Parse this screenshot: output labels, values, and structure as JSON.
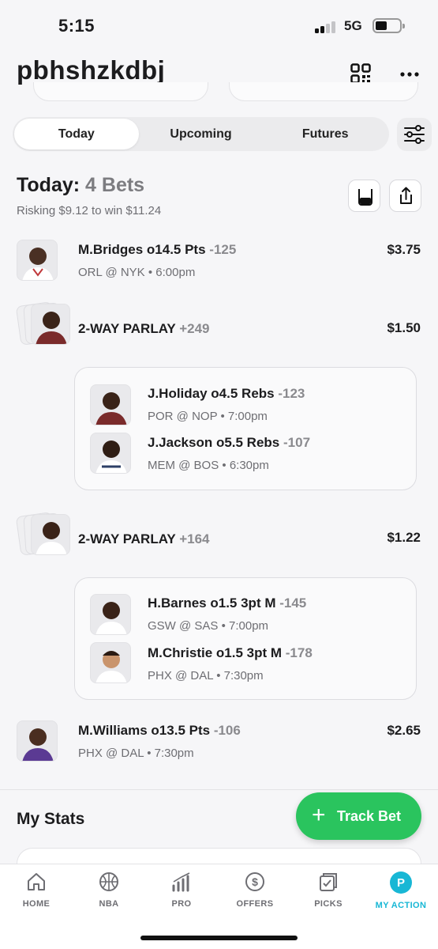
{
  "status": {
    "time": "5:15",
    "network": "5G"
  },
  "header": {
    "title": "pbhshzkdbj",
    "icons": [
      "qr-code-icon",
      "more-icon"
    ]
  },
  "tabs": [
    {
      "label": "Today",
      "active": true
    },
    {
      "label": "Upcoming",
      "active": false
    },
    {
      "label": "Futures",
      "active": false
    }
  ],
  "summary": {
    "title_prefix": "Today:",
    "count": "4 Bets",
    "risk_line": "Risking $9.12 to win $11.24"
  },
  "bets": [
    {
      "title": "M.Bridges o14.5 Pts",
      "odds": "-125",
      "game": "ORL @ NYK • 6:00pm",
      "amount": "$3.75"
    },
    {
      "title": "2-WAY PARLAY",
      "odds": "+249",
      "amount": "$1.50",
      "legs": [
        {
          "title": "J.Holiday o4.5 Rebs",
          "odds": "-123",
          "game": "POR @ NOP • 7:00pm"
        },
        {
          "title": "J.Jackson o5.5 Rebs",
          "odds": "-107",
          "game": "MEM @ BOS • 6:30pm"
        }
      ]
    },
    {
      "title": "2-WAY PARLAY",
      "odds": "+164",
      "amount": "$1.22",
      "legs": [
        {
          "title": "H.Barnes o1.5 3pt M",
          "odds": "-145",
          "game": "GSW @ SAS • 7:00pm"
        },
        {
          "title": "M.Christie o1.5 3pt M",
          "odds": "-178",
          "game": "PHX @ DAL • 7:30pm"
        }
      ]
    },
    {
      "title": "M.Williams o13.5 Pts",
      "odds": "-106",
      "game": "PHX @ DAL • 7:30pm",
      "amount": "$2.65"
    }
  ],
  "stats": {
    "title": "My Stats"
  },
  "track_button": {
    "label": "Track Bet"
  },
  "nav": [
    {
      "label": "HOME",
      "icon": "home-icon"
    },
    {
      "label": "NBA",
      "icon": "basketball-icon"
    },
    {
      "label": "PRO",
      "icon": "chart-icon"
    },
    {
      "label": "OFFERS",
      "icon": "dollar-icon"
    },
    {
      "label": "PICKS",
      "icon": "picks-icon"
    },
    {
      "label": "MY ACTION",
      "icon": "profile-icon",
      "active": true
    }
  ],
  "colors": {
    "accent_green": "#2ac45e",
    "active_nav": "#18b7d5"
  }
}
